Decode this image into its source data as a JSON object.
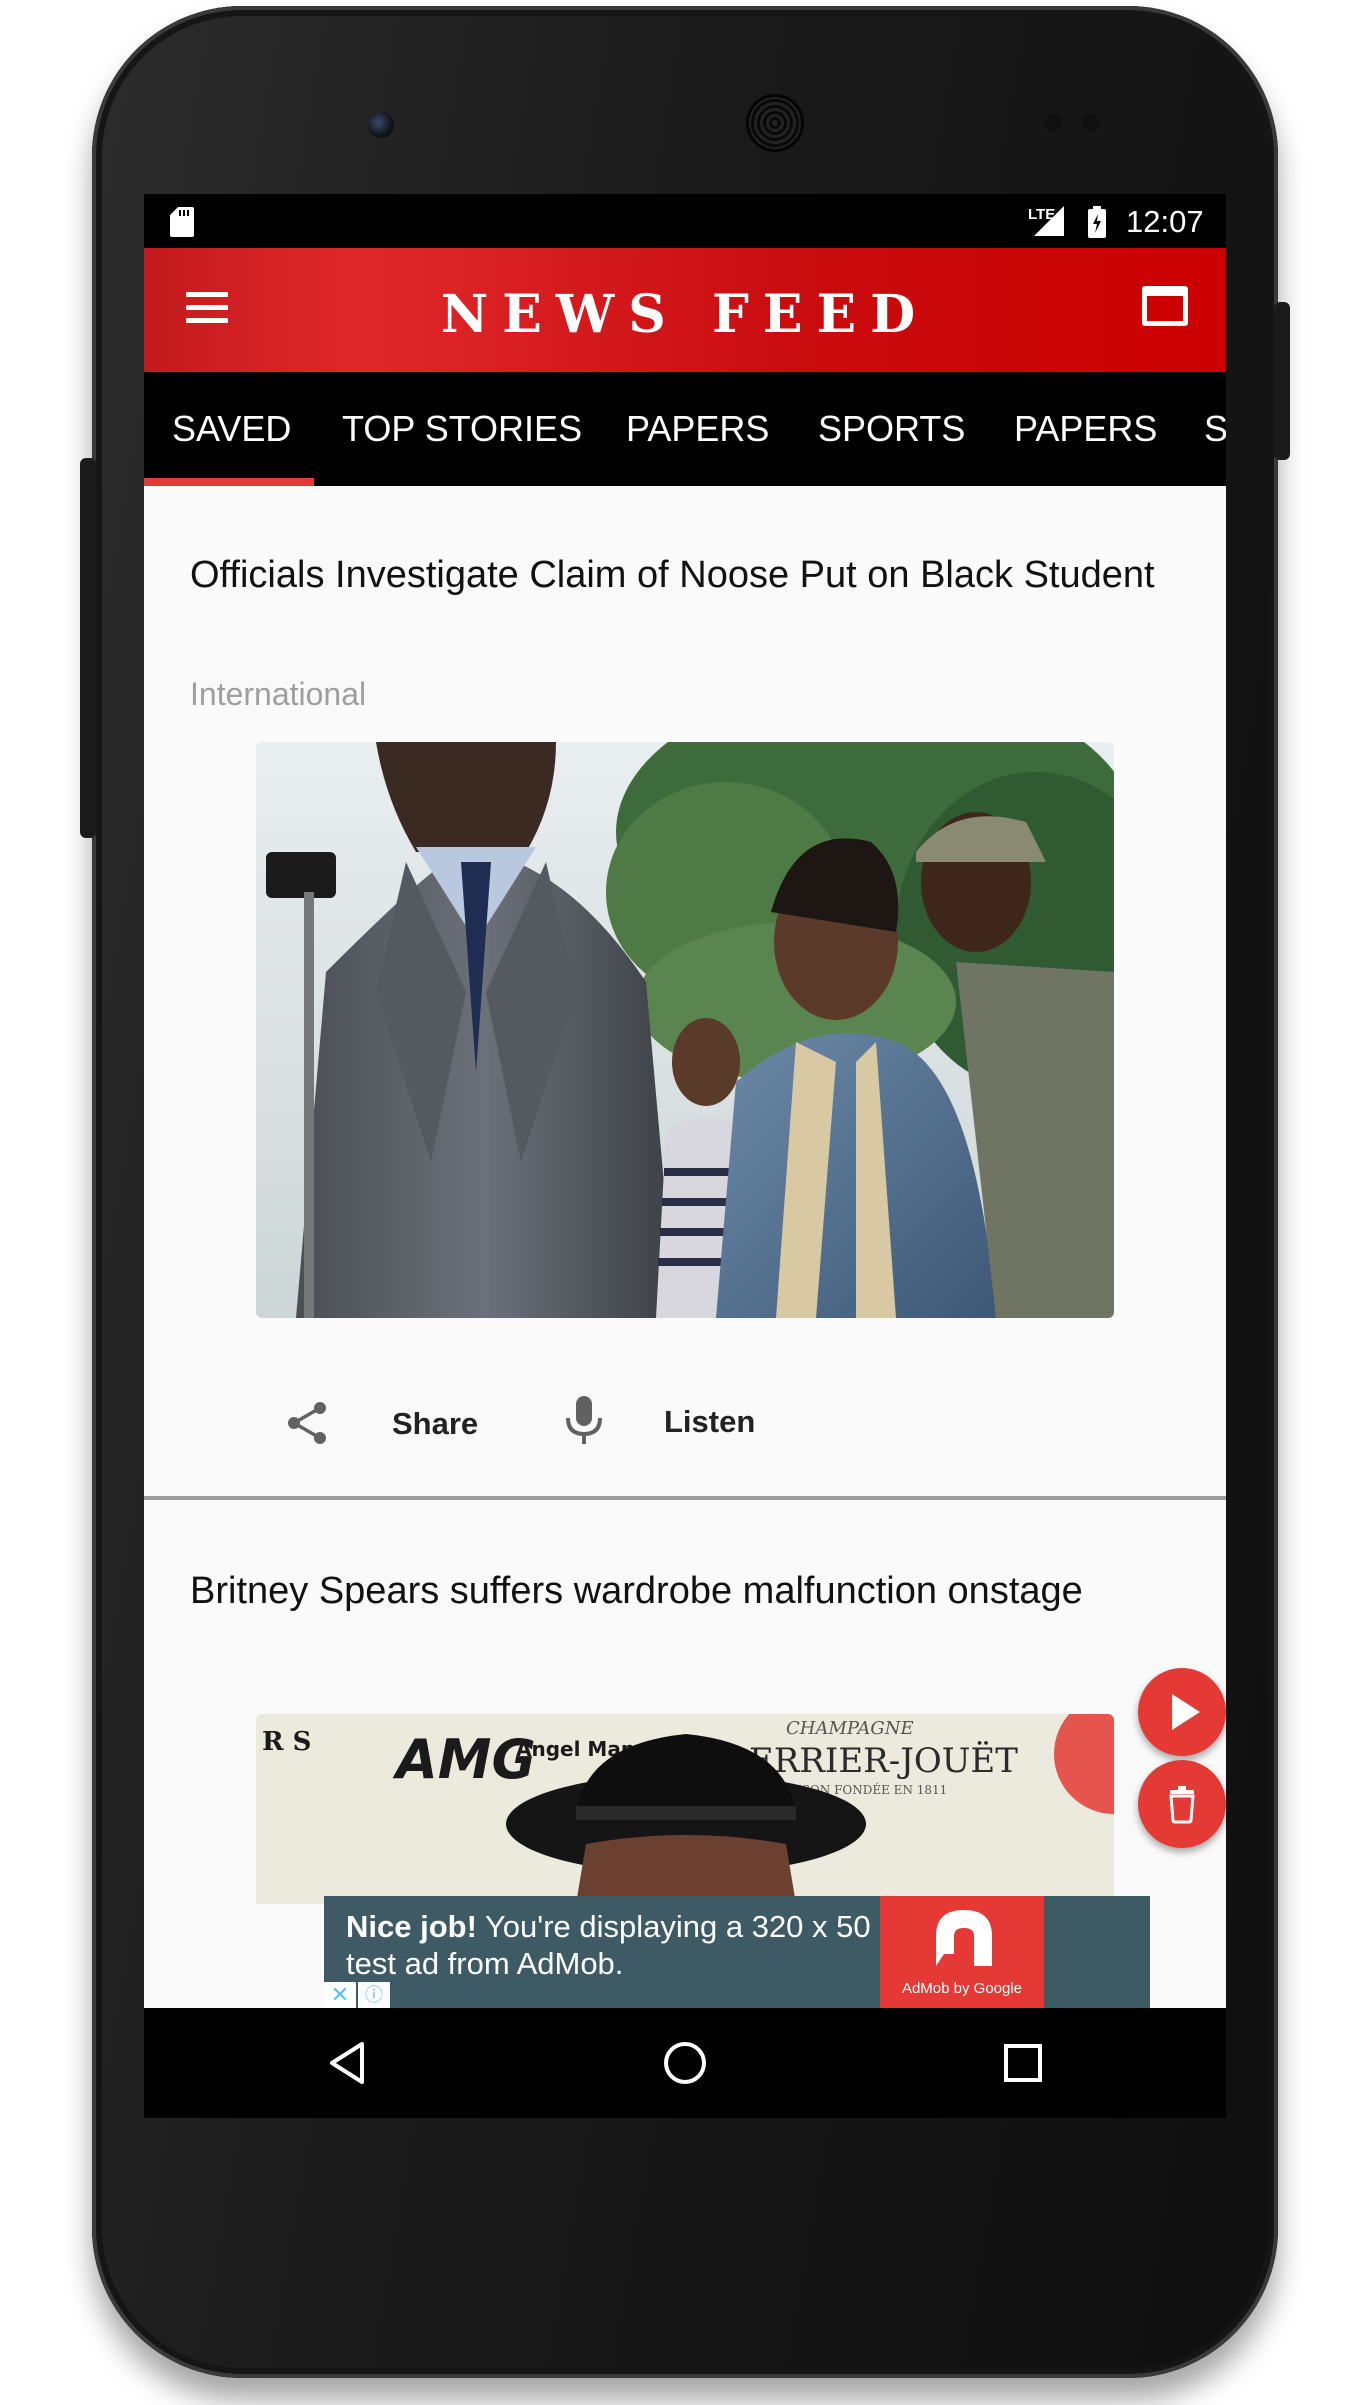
{
  "status_bar": {
    "network": "LTE",
    "time": "12:07"
  },
  "app_bar": {
    "title": "NEWS FEED"
  },
  "tabs": [
    {
      "label": "SAVED"
    },
    {
      "label": "TOP STORIES"
    },
    {
      "label": "PAPERS"
    },
    {
      "label": "SPORTS"
    },
    {
      "label": "PAPERS"
    },
    {
      "label": "S"
    }
  ],
  "active_tab": "SAVED",
  "articles": [
    {
      "title": " Officials Investigate Claim of Noose Put on Black Student",
      "category": "International",
      "actions": {
        "share_label": "Share",
        "listen_label": "Listen"
      }
    },
    {
      "title": "Britney Spears suffers wardrobe malfunction onstage",
      "photo_text": {
        "brand_left": "AMG",
        "brand_sub": "Angel Mana",
        "brand_script": "CHAMPAGNE",
        "brand_right": "PERRIER-JOUËT",
        "brand_right_sub": "MAISON FONDÉE EN 1811",
        "partial_left": "R S"
      }
    }
  ],
  "ad_banner": {
    "lead": "Nice job!",
    "text": " You're displaying a 320 x 50 test ad from AdMob.",
    "logo_label": "AdMob by Google",
    "close": "✕",
    "info": "ⓘ"
  },
  "colors": {
    "accent": "#E53935",
    "app_bar": "#CC0000",
    "tab_bar": "#000000"
  },
  "icons": [
    "sd-card-icon",
    "signal-icon",
    "battery-icon",
    "menu-icon",
    "window-icon",
    "share-icon",
    "mic-icon",
    "play-icon",
    "trash-icon",
    "back-icon",
    "home-icon",
    "recents-icon"
  ]
}
